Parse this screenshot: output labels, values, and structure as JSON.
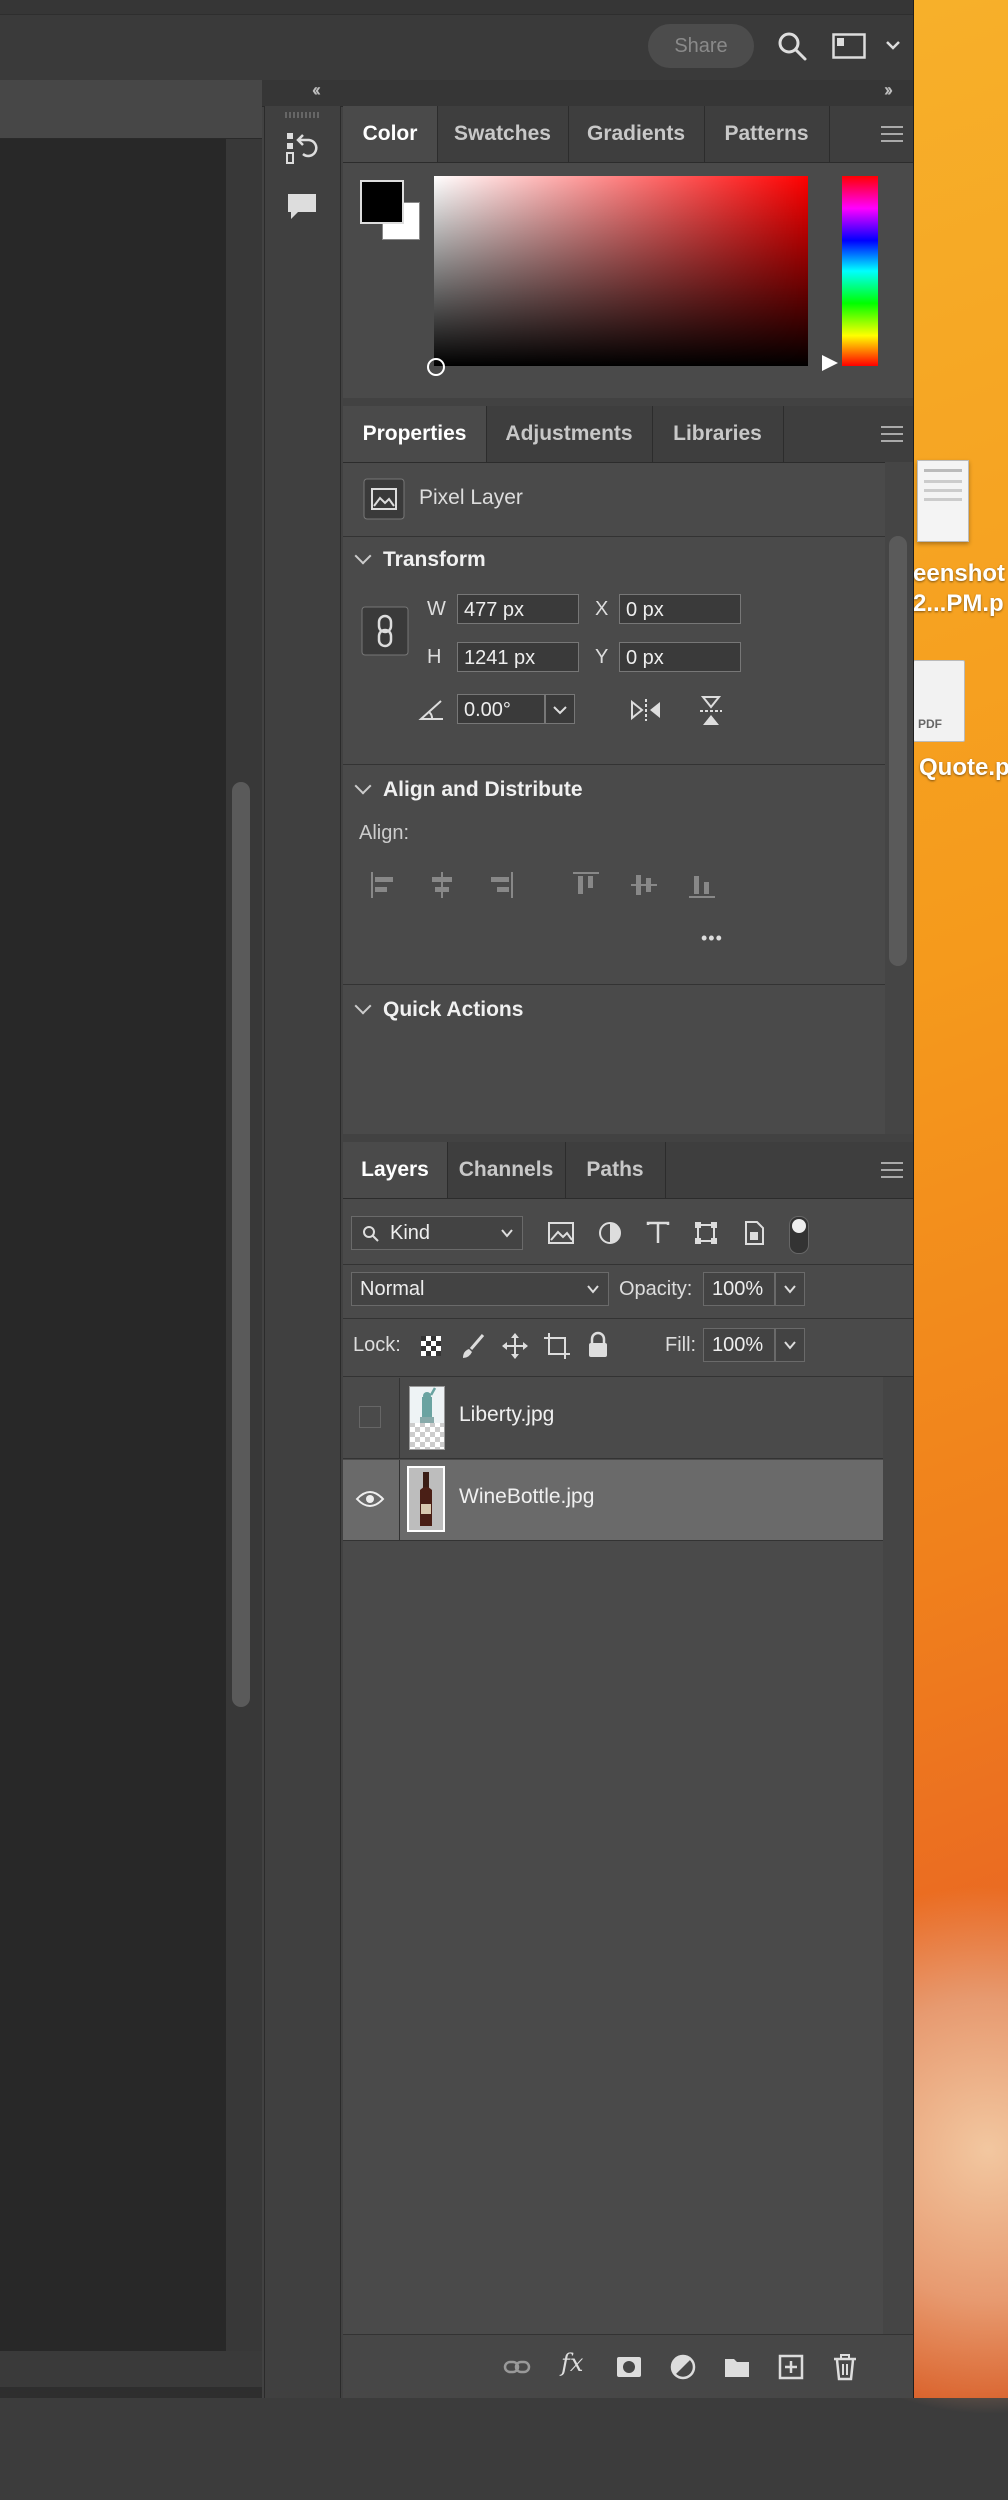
{
  "top_bar": {
    "share_label": "Share"
  },
  "color_panel": {
    "tabs": [
      "Color",
      "Swatches",
      "Gradients",
      "Patterns"
    ],
    "foreground": "#000000",
    "background": "#ffffff",
    "base_hue": "#ff0000"
  },
  "properties_panel": {
    "tabs": [
      "Properties",
      "Adjustments",
      "Libraries"
    ],
    "layer_type": "Pixel Layer",
    "transform": {
      "heading": "Transform",
      "w_label": "W",
      "w_value": "477 px",
      "h_label": "H",
      "h_value": "1241 px",
      "x_label": "X",
      "x_value": "0 px",
      "y_label": "Y",
      "y_value": "0 px",
      "angle_value": "0.00°"
    },
    "align": {
      "heading": "Align and Distribute",
      "label": "Align:",
      "more": "•••"
    },
    "quick_actions": {
      "heading": "Quick Actions"
    }
  },
  "layers_panel": {
    "tabs": [
      "Layers",
      "Channels",
      "Paths"
    ],
    "filter_kind": "Kind",
    "blend_mode": "Normal",
    "opacity_label": "Opacity:",
    "opacity_value": "100%",
    "lock_label": "Lock:",
    "fill_label": "Fill:",
    "fill_value": "100%",
    "layers": [
      {
        "name": "Liberty.jpg",
        "visible": false,
        "selected": false
      },
      {
        "name": "WineBottle.jpg",
        "visible": true,
        "selected": true
      }
    ],
    "bottom_icons": [
      "link-icon",
      "fx-icon",
      "mask-icon",
      "adjustment-icon",
      "folder-icon",
      "new-layer-icon",
      "trash-icon"
    ],
    "fx_label": "fx"
  },
  "desktop": {
    "file1_label_line1": "eenshot",
    "file1_label_line2": "2...PM.p",
    "file2_badge": "PDF",
    "file2_label": "Quote.p"
  }
}
